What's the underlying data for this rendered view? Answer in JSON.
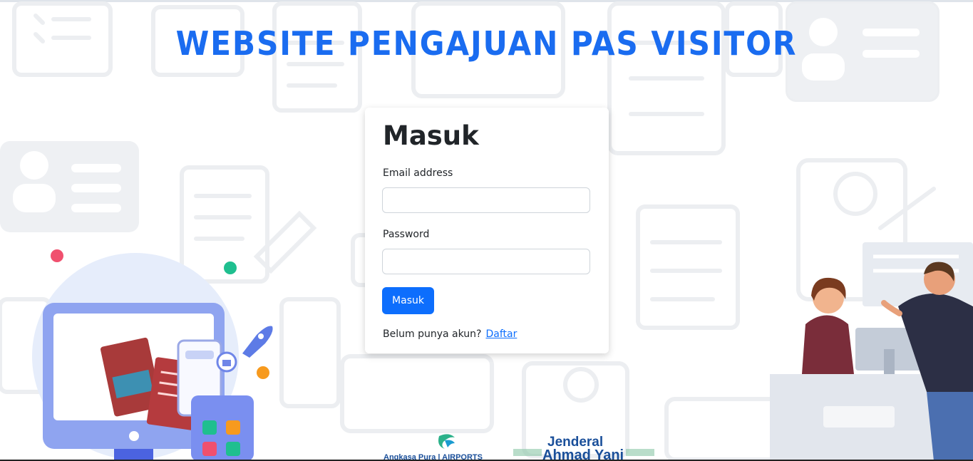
{
  "page": {
    "headline": "WEBSITE PENGAJUAN PAS VISITOR"
  },
  "login": {
    "title": "Masuk",
    "email_label": "Email address",
    "email_value": "",
    "password_label": "Password",
    "password_value": "",
    "submit_label": "Masuk",
    "signup_prompt": "Belum punya akun?",
    "signup_link": "Daftar"
  },
  "footer_logos": {
    "operator": "Angkasa Pura | AIRPORTS",
    "airport_name_line1": "Jenderal",
    "airport_name_line2": "Ahmad Yani"
  },
  "colors": {
    "accent": "#0d6efd",
    "headline": "#1a6cf0",
    "card_bg": "#ffffff"
  }
}
